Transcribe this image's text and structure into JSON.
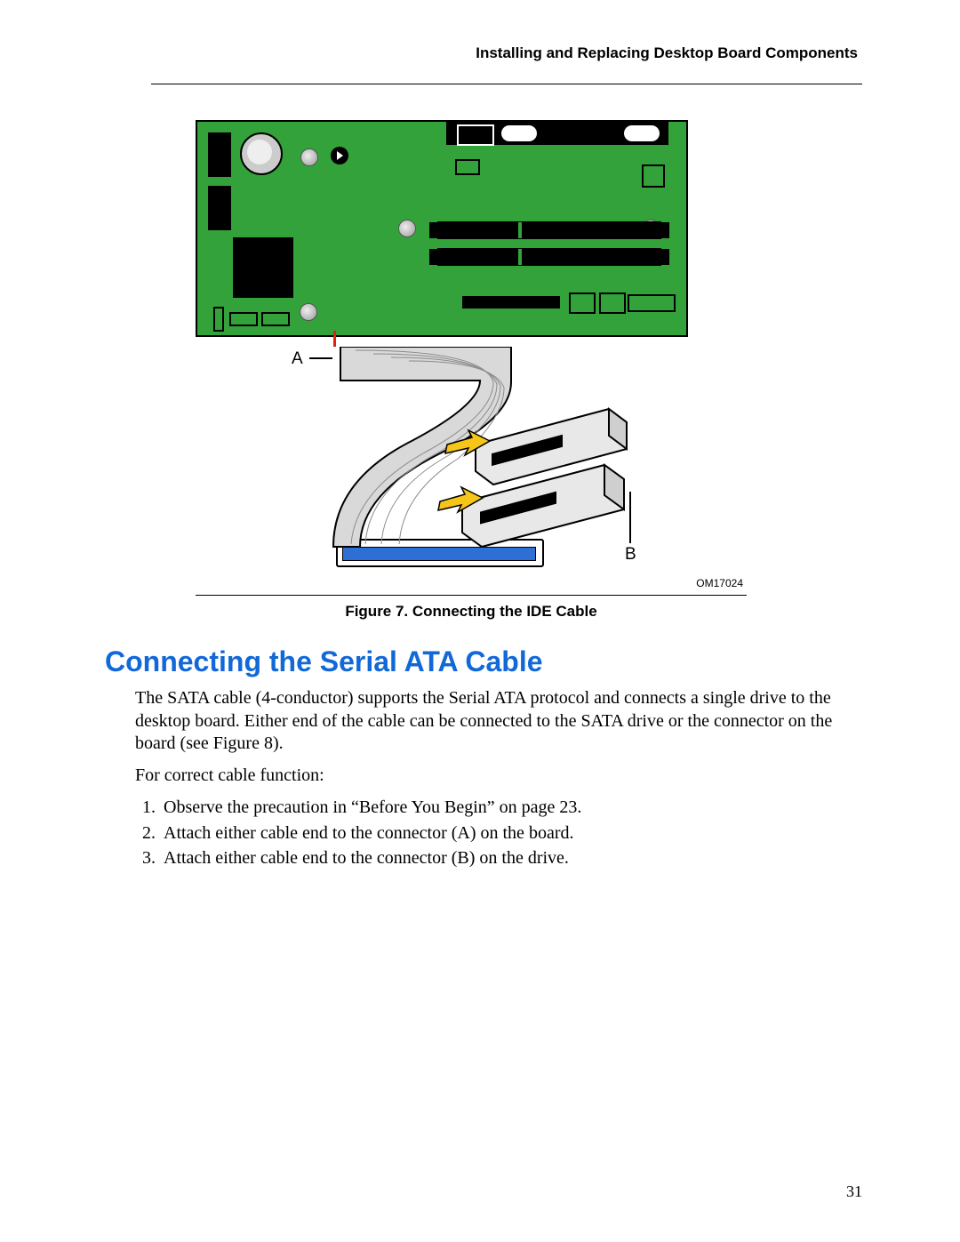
{
  "header": {
    "running_title": "Installing and Replacing Desktop Board Components"
  },
  "figure": {
    "label_a": "A",
    "label_b": "B",
    "image_code": "OM17024",
    "caption": "Figure 7.  Connecting the IDE Cable"
  },
  "section": {
    "title": "Connecting the Serial ATA Cable",
    "para1": "The SATA cable (4-conductor) supports the Serial ATA protocol and connects a single drive to the desktop board.  Either end of the cable can be connected to the SATA drive or the connector on the board (see Figure 8).",
    "para2": "For correct cable function:"
  },
  "steps": [
    "Observe the precaution in “Before You Begin” on page 23.",
    "Attach either cable end to the connector (A) on the board.",
    "Attach either cable end to the connector (B) on the drive."
  ],
  "page_number": "31"
}
